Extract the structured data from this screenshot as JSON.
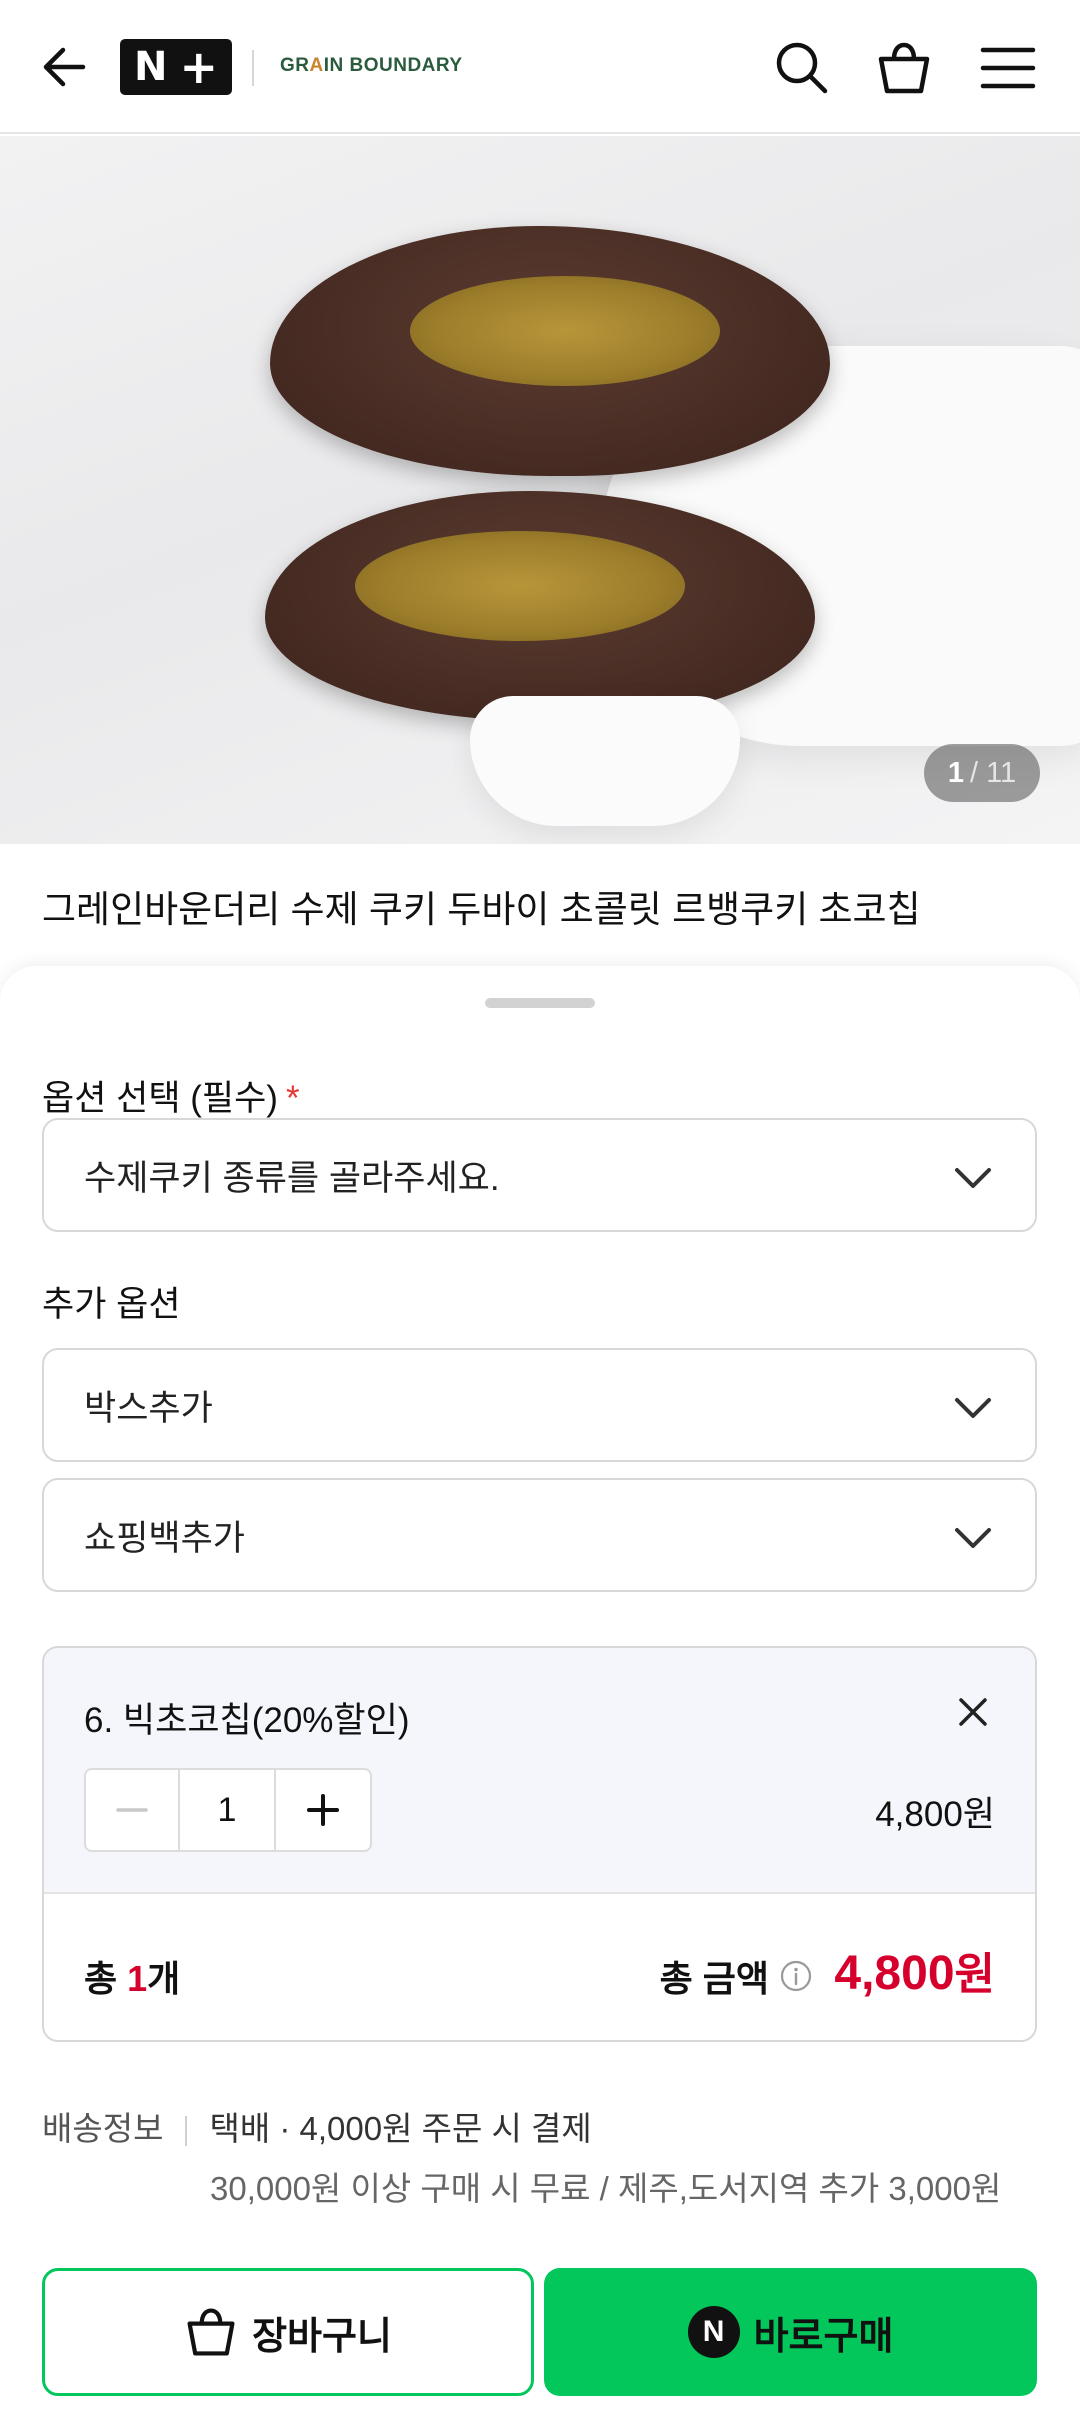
{
  "header": {
    "nplus_n": "N",
    "nplus_plus": "+",
    "brand_pre": "GR",
    "brand_a": "A",
    "brand_post": "IN BOUNDARY",
    "brand_y_pre": "BOUND",
    "brand_a2": "A",
    "brand_y_post": "RY"
  },
  "image": {
    "current": "1",
    "total": "11"
  },
  "product": {
    "title": "그레인바운더리 수제 쿠키 두바이 초콜릿 르뱅쿠키 초코칩"
  },
  "sheet": {
    "option_label": "옵션 선택 (필수)",
    "required_mark": "*",
    "option_placeholder": "수제쿠키 종류를 골라주세요.",
    "extra_label": "추가 옵션",
    "extra_options": [
      "박스추가",
      "쇼핑백추가"
    ]
  },
  "selected": {
    "name": "6. 빅초코칩(20%할인)",
    "qty": "1",
    "price": "4,800원",
    "total_prefix": "총 ",
    "total_count": "1",
    "total_suffix": "개",
    "total_label": "총 금액",
    "total_amount": "4,800",
    "total_won": "원"
  },
  "delivery": {
    "label": "배송정보",
    "value": "택배 · 4,000원 주문 시 결제",
    "note": "30,000원 이상 구매 시 무료 / 제주,도서지역 추가 3,000원"
  },
  "buttons": {
    "cart": "장바구니",
    "buy": "바로구매",
    "buy_badge": "N"
  },
  "colors": {
    "naver_green": "#03c75a",
    "price_red": "#d6002c",
    "required_red": "#e53935"
  }
}
